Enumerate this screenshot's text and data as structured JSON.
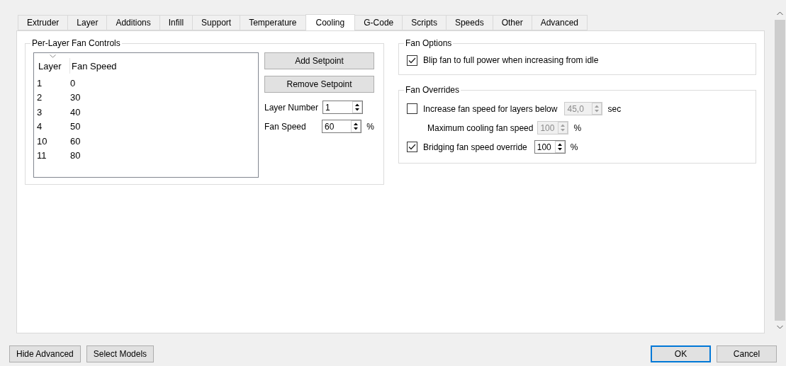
{
  "tabs": [
    {
      "label": "Extruder",
      "selected": false
    },
    {
      "label": "Layer",
      "selected": false
    },
    {
      "label": "Additions",
      "selected": false
    },
    {
      "label": "Infill",
      "selected": false
    },
    {
      "label": "Support",
      "selected": false
    },
    {
      "label": "Temperature",
      "selected": false
    },
    {
      "label": "Cooling",
      "selected": true
    },
    {
      "label": "G-Code",
      "selected": false
    },
    {
      "label": "Scripts",
      "selected": false
    },
    {
      "label": "Speeds",
      "selected": false
    },
    {
      "label": "Other",
      "selected": false
    },
    {
      "label": "Advanced",
      "selected": false
    }
  ],
  "per_layer_fan_controls": {
    "title": "Per-Layer Fan Controls",
    "table": {
      "columns": [
        "Layer",
        "Fan Speed"
      ],
      "rows": [
        [
          "1",
          "0"
        ],
        [
          "2",
          "30"
        ],
        [
          "3",
          "40"
        ],
        [
          "4",
          "50"
        ],
        [
          "10",
          "60"
        ],
        [
          "11",
          "80"
        ]
      ]
    },
    "buttons": [
      "Add Setpoint",
      "Remove Setpoint"
    ],
    "fields": [
      {
        "label": "Layer Number",
        "value": "1"
      },
      {
        "label": "Fan Speed",
        "value": "60",
        "unit": "%"
      }
    ]
  },
  "fan_options": {
    "title": "Fan Options",
    "items": [
      {
        "label": "Blip fan to full power when increasing from idle",
        "checked": true
      }
    ]
  },
  "fan_overrides": {
    "title": "Fan Overrides",
    "rows": [
      {
        "kind": "check",
        "label": "Increase fan speed for layers below",
        "checked": false,
        "spin": {
          "value": "45,0",
          "unit": "sec",
          "disabled": true
        }
      },
      {
        "kind": "sub",
        "label": "Maximum cooling fan speed",
        "spin": {
          "value": "100",
          "unit": "%",
          "disabled": true
        }
      },
      {
        "kind": "check",
        "label": "Bridging fan speed override",
        "checked": true,
        "spin": {
          "value": "100",
          "unit": "%",
          "disabled": false
        }
      }
    ]
  },
  "footer": {
    "left_buttons": [
      {
        "label": "Hide Advanced",
        "default": false
      },
      {
        "label": "Select Models",
        "default": false
      }
    ],
    "right_buttons": [
      {
        "label": "OK",
        "default": true
      },
      {
        "label": "Cancel",
        "default": false
      }
    ]
  }
}
